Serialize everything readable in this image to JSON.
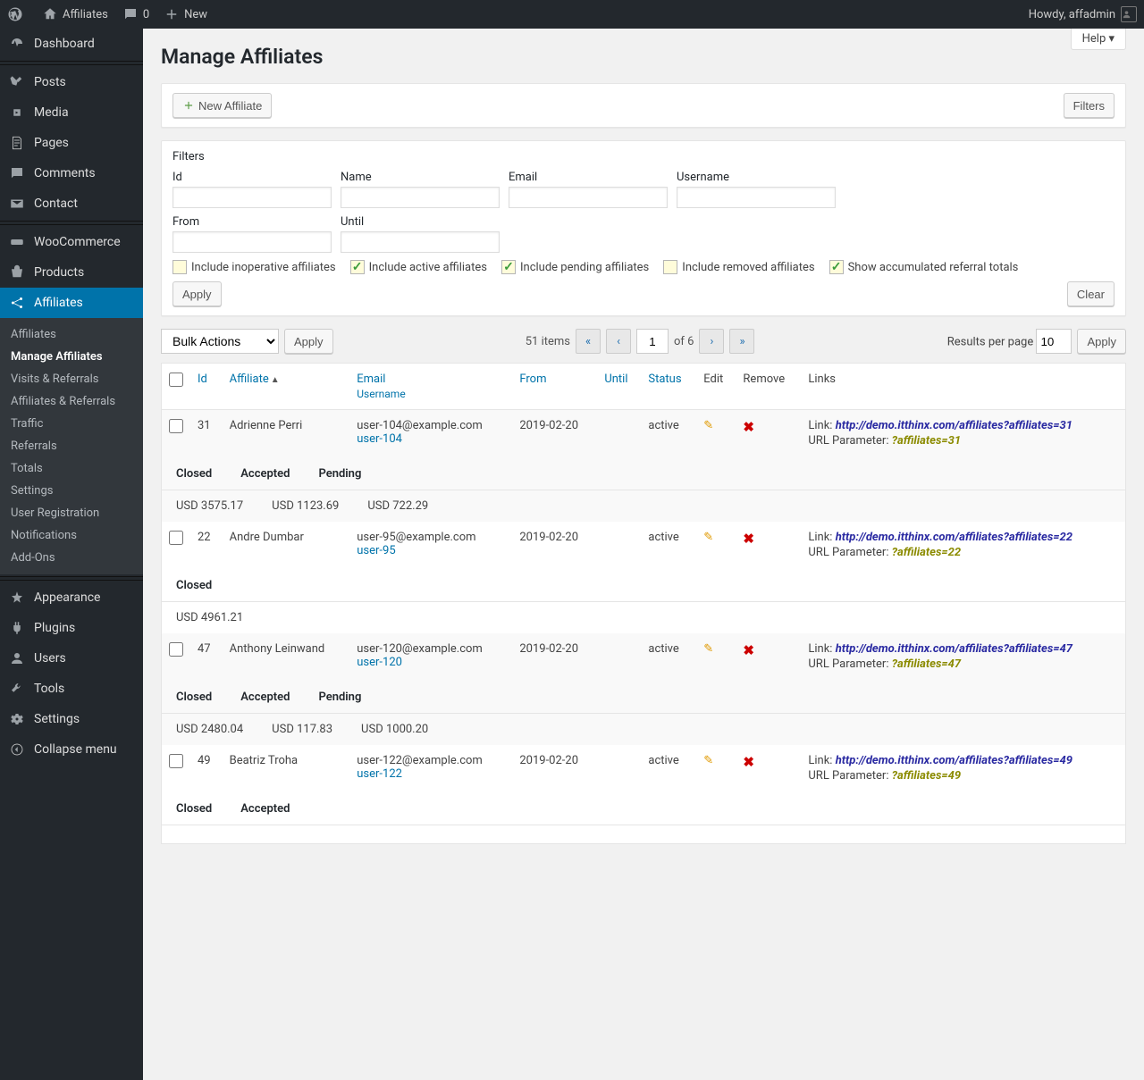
{
  "adminbar": {
    "site_name": "Affiliates",
    "comments_count": "0",
    "new_label": "New",
    "howdy": "Howdy, affadmin"
  },
  "sidebar": {
    "items": [
      {
        "id": "dashboard",
        "label": "Dashboard"
      },
      {
        "id": "posts",
        "label": "Posts"
      },
      {
        "id": "media",
        "label": "Media"
      },
      {
        "id": "pages",
        "label": "Pages"
      },
      {
        "id": "comments",
        "label": "Comments"
      },
      {
        "id": "contact",
        "label": "Contact"
      },
      {
        "id": "woocommerce",
        "label": "WooCommerce"
      },
      {
        "id": "products",
        "label": "Products"
      },
      {
        "id": "affiliates",
        "label": "Affiliates",
        "current": true
      },
      {
        "id": "appearance",
        "label": "Appearance"
      },
      {
        "id": "plugins",
        "label": "Plugins"
      },
      {
        "id": "users",
        "label": "Users"
      },
      {
        "id": "tools",
        "label": "Tools"
      },
      {
        "id": "settings",
        "label": "Settings"
      },
      {
        "id": "collapse",
        "label": "Collapse menu"
      }
    ],
    "submenu": [
      "Affiliates",
      "Manage Affiliates",
      "Visits & Referrals",
      "Affiliates & Referrals",
      "Traffic",
      "Referrals",
      "Totals",
      "Settings",
      "User Registration",
      "Notifications",
      "Add-Ons"
    ],
    "submenu_current": 1
  },
  "page": {
    "title": "Manage Affiliates",
    "help": "Help",
    "new_affiliate": "New Affiliate",
    "filters_btn": "Filters"
  },
  "filters": {
    "heading": "Filters",
    "labels": {
      "id": "Id",
      "name": "Name",
      "email": "Email",
      "username": "Username",
      "from": "From",
      "until": "Until"
    },
    "checkboxes": [
      {
        "label": "Include inoperative affiliates",
        "checked": false
      },
      {
        "label": "Include active affiliates",
        "checked": true
      },
      {
        "label": "Include pending affiliates",
        "checked": true
      },
      {
        "label": "Include removed affiliates",
        "checked": false
      },
      {
        "label": "Show accumulated referral totals",
        "checked": true
      }
    ],
    "apply": "Apply",
    "clear": "Clear"
  },
  "bulk": {
    "placeholder": "Bulk Actions",
    "apply": "Apply"
  },
  "pagination": {
    "total_label": "51 items",
    "page": "1",
    "of_label": "of 6"
  },
  "rpp": {
    "label": "Results per page",
    "value": "10",
    "apply": "Apply"
  },
  "columns": {
    "id": "Id",
    "affiliate": "Affiliate",
    "email": "Email",
    "username": "Username",
    "from": "From",
    "until": "Until",
    "status": "Status",
    "edit": "Edit",
    "remove": "Remove",
    "links": "Links"
  },
  "ref_cols": {
    "closed": "Closed",
    "accepted": "Accepted",
    "pending": "Pending"
  },
  "link_labels": {
    "link": "Link:",
    "url_param": "URL Parameter:"
  },
  "rows": [
    {
      "id": "31",
      "name": "Adrienne Perri",
      "email": "user-104@example.com",
      "username": "user-104",
      "from": "2019-02-20",
      "status": "active",
      "link": "http://demo.itthinx.com/affiliates?affiliates=31",
      "param": "?affiliates=31",
      "refs": [
        {
          "label": "Closed",
          "val": "USD 3575.17"
        },
        {
          "label": "Accepted",
          "val": "USD 1123.69"
        },
        {
          "label": "Pending",
          "val": "USD 722.29"
        }
      ]
    },
    {
      "id": "22",
      "name": "Andre Dumbar",
      "email": "user-95@example.com",
      "username": "user-95",
      "from": "2019-02-20",
      "status": "active",
      "link": "http://demo.itthinx.com/affiliates?affiliates=22",
      "param": "?affiliates=22",
      "refs": [
        {
          "label": "Closed",
          "val": "USD 4961.21"
        }
      ]
    },
    {
      "id": "47",
      "name": "Anthony Leinwand",
      "email": "user-120@example.com",
      "username": "user-120",
      "from": "2019-02-20",
      "status": "active",
      "link": "http://demo.itthinx.com/affiliates?affiliates=47",
      "param": "?affiliates=47",
      "refs": [
        {
          "label": "Closed",
          "val": "USD 2480.04"
        },
        {
          "label": "Accepted",
          "val": "USD 117.83"
        },
        {
          "label": "Pending",
          "val": "USD 1000.20"
        }
      ]
    },
    {
      "id": "49",
      "name": "Beatriz Troha",
      "email": "user-122@example.com",
      "username": "user-122",
      "from": "2019-02-20",
      "status": "active",
      "link": "http://demo.itthinx.com/affiliates?affiliates=49",
      "param": "?affiliates=49",
      "refs": [
        {
          "label": "Closed"
        },
        {
          "label": "Accepted"
        }
      ]
    }
  ]
}
